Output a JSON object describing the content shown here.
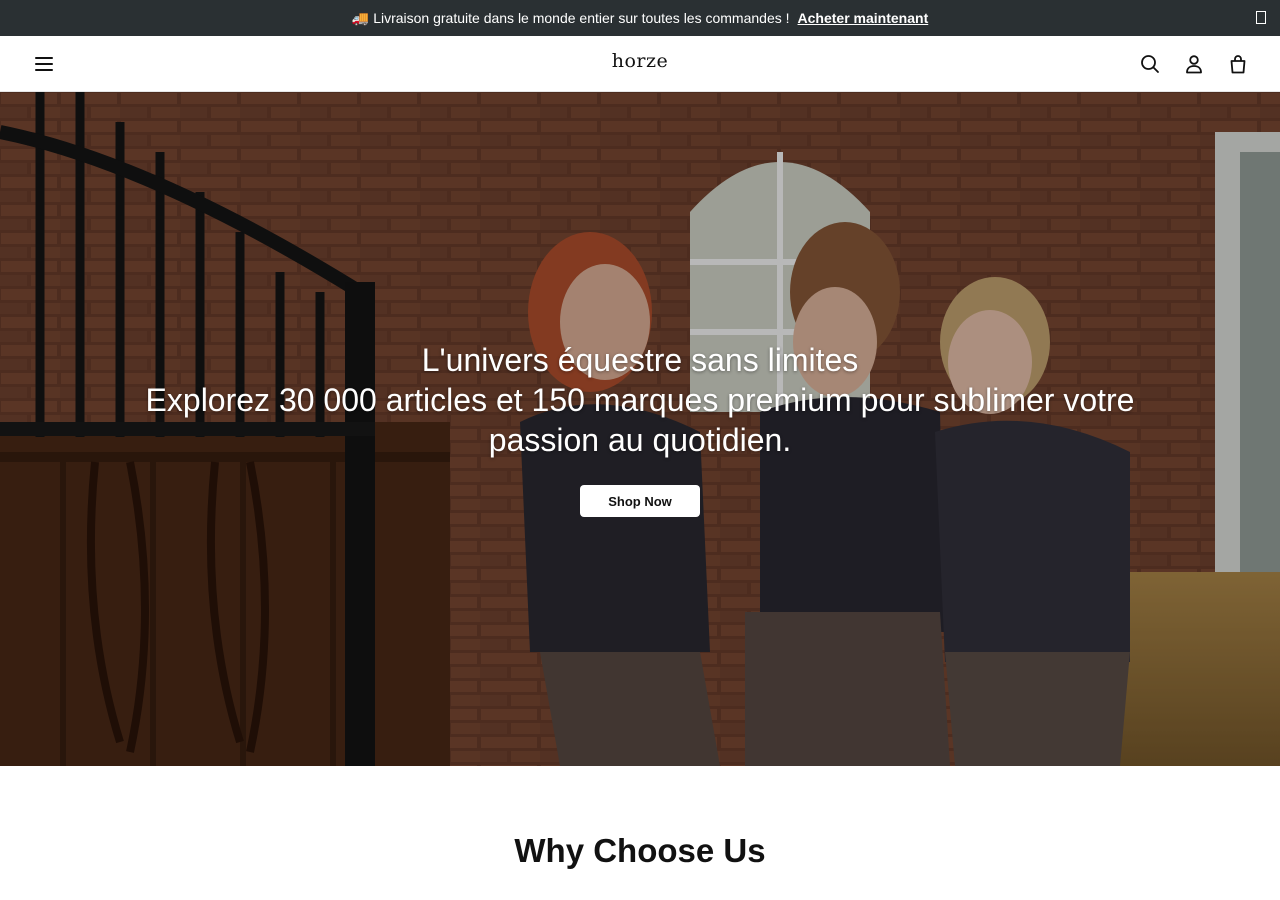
{
  "announcement": {
    "truck_icon": "🚚",
    "message": "Livraison gratuite dans le monde entier sur toutes les commandes !",
    "link": "Acheter maintenant",
    "close_icon": "close-icon"
  },
  "header": {
    "menu_icon": "hamburger-menu-icon",
    "logo": "horze",
    "icons": [
      "search-icon",
      "account-icon",
      "shopping-bag-icon"
    ]
  },
  "hero": {
    "headline": "L'univers équestre sans limites",
    "subline": "Explorez 30 000 articles et 150 marques premium pour sublimer votre passion au quotidien.",
    "cta": "Shop Now"
  },
  "why_section": {
    "title": "Why Choose Us"
  },
  "colors": {
    "announcement_bg": "#2a3033",
    "text": "#111111",
    "button_bg": "#ffffff"
  }
}
